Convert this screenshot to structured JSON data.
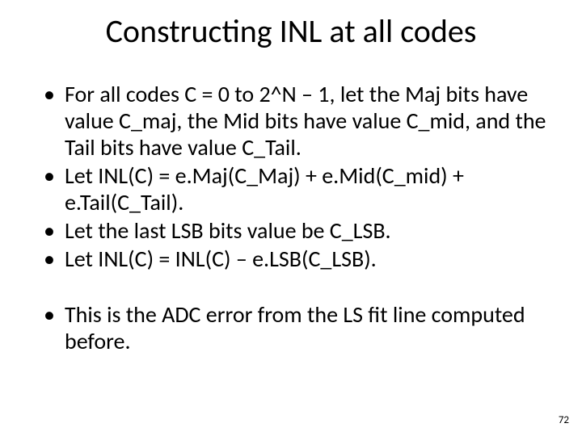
{
  "title": "Constructing INL at all codes",
  "bullets": [
    "For all codes C = 0 to 2^N – 1, let the Maj bits have value C_maj, the Mid bits have value C_mid, and the Tail bits have value C_Tail.",
    "Let INL(C) = e.Maj(C_Maj) + e.Mid(C_mid) + e.Tail(C_Tail).",
    "Let the last LSB bits value be C_LSB.",
    "Let INL(C) = INL(C) – e.LSB(C_LSB)."
  ],
  "bullets2": [
    "This is the ADC error from the LS fit line computed before."
  ],
  "page_number": "72"
}
